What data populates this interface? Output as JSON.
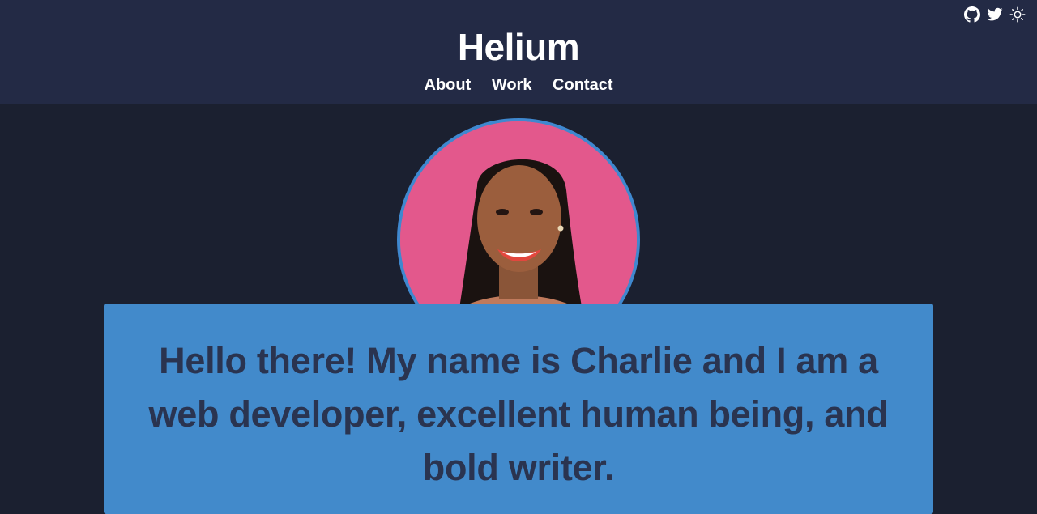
{
  "site": {
    "title": "Helium"
  },
  "nav": {
    "items": [
      {
        "label": "About"
      },
      {
        "label": "Work"
      },
      {
        "label": "Contact"
      }
    ]
  },
  "header_icons": [
    {
      "icon": "github-icon"
    },
    {
      "icon": "twitter-icon"
    },
    {
      "icon": "sun-icon"
    }
  ],
  "hero": {
    "text": "Hello there! My name is Charlie and I am a web developer, excellent human being, and bold writer."
  },
  "colors": {
    "header_bg": "#232a45",
    "page_bg": "#1b2030",
    "accent": "#428acb",
    "hero_text": "#2a3450"
  }
}
